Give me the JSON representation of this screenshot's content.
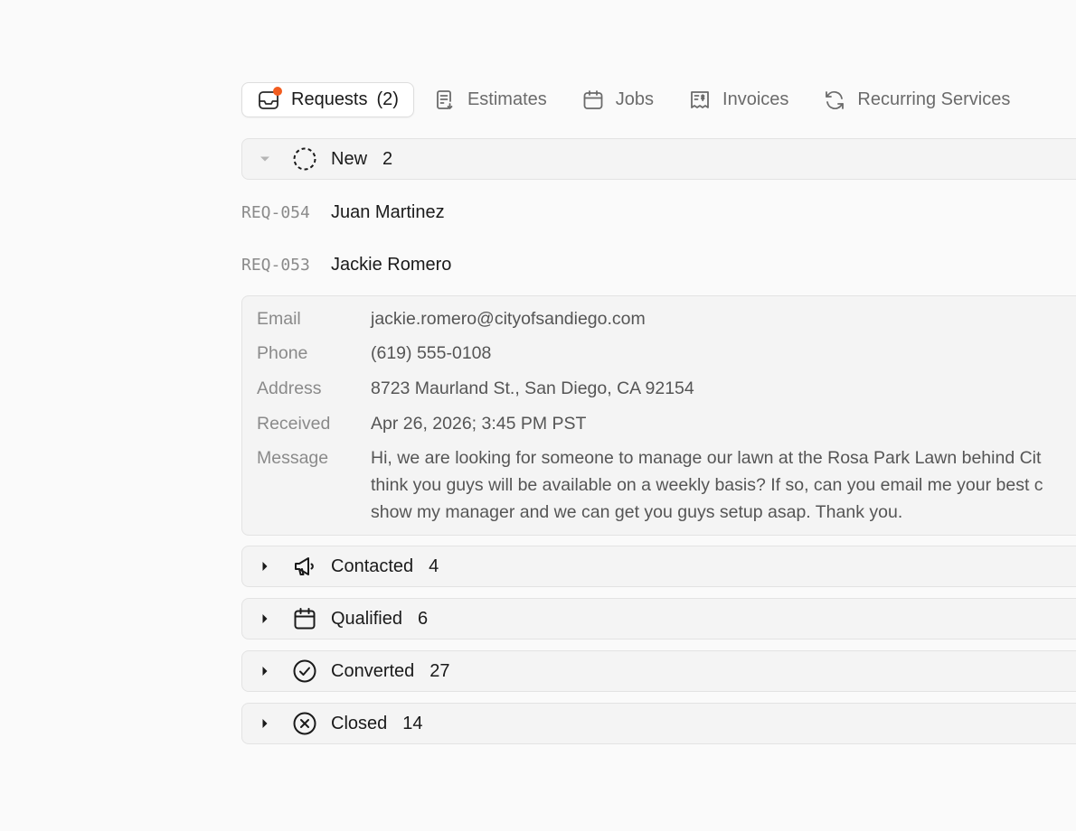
{
  "tabs": [
    {
      "label": "Requests",
      "count": "(2)",
      "icon": "inbox-icon",
      "active": true
    },
    {
      "label": "Estimates",
      "icon": "estimate-document-icon"
    },
    {
      "label": "Jobs",
      "icon": "calendar-icon"
    },
    {
      "label": "Invoices",
      "icon": "invoice-icon"
    },
    {
      "label": "Recurring Services",
      "icon": "refresh-icon"
    }
  ],
  "groups": {
    "new": {
      "label": "New",
      "count": "2",
      "icon": "dashed-circle-icon",
      "expanded": true
    },
    "contacted": {
      "label": "Contacted",
      "count": "4",
      "icon": "megaphone-icon"
    },
    "qualified": {
      "label": "Qualified",
      "count": "6",
      "icon": "calendar-icon"
    },
    "converted": {
      "label": "Converted",
      "count": "27",
      "icon": "check-circle-icon"
    },
    "closed": {
      "label": "Closed",
      "count": "14",
      "icon": "x-circle-icon"
    }
  },
  "requests": [
    {
      "id": "REQ-054",
      "name": "Juan Martinez"
    },
    {
      "id": "REQ-053",
      "name": "Jackie Romero"
    }
  ],
  "detail": {
    "email_label": "Email",
    "email": "jackie.romero@cityofsandiego.com",
    "phone_label": "Phone",
    "phone": "(619) 555-0108",
    "address_label": "Address",
    "address": "8723 Maurland St., San Diego, CA 92154",
    "received_label": "Received",
    "received": "Apr 26, 2026; 3:45 PM PST",
    "message_label": "Message",
    "message_lines": [
      "Hi, we are looking for someone to manage our lawn at the Rosa Park Lawn behind Cit",
      "think you guys will be available on a weekly basis? If so, can you email me your best c",
      "show my manager and we can get you guys setup asap. Thank you."
    ]
  },
  "colors": {
    "notification_dot": "#f25c1f",
    "background": "#fafafa",
    "panel": "#f4f4f4"
  }
}
